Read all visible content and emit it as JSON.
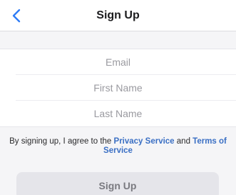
{
  "header": {
    "title": "Sign Up",
    "back_icon": "chevron-left-icon",
    "accent_color": "#2f7cf6"
  },
  "form": {
    "email_placeholder": "Email",
    "first_name_placeholder": "First Name",
    "last_name_placeholder": "Last Name"
  },
  "terms": {
    "prefix": "By signing up, I agree to the ",
    "privacy_link": "Privacy Service",
    "middle": " and ",
    "terms_link": "Terms of Service"
  },
  "actions": {
    "signup_label": "Sign Up"
  }
}
